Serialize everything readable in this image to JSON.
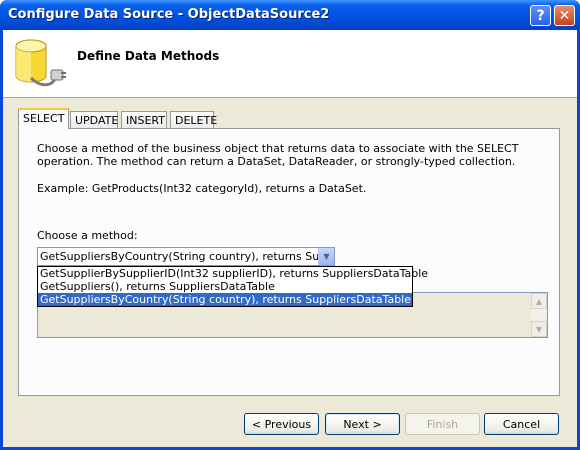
{
  "window": {
    "title": "Configure Data Source - ObjectDataSource2",
    "help_label": "?",
    "close_label": "✕"
  },
  "header": {
    "title": "Define Data Methods",
    "icon": "database-plug-icon"
  },
  "tabs": [
    {
      "label": "SELECT",
      "active": true
    },
    {
      "label": "UPDATE",
      "active": false
    },
    {
      "label": "INSERT",
      "active": false
    },
    {
      "label": "DELETE",
      "active": false
    }
  ],
  "select_tab": {
    "description": "Choose a method of the business object that returns data to associate with the SELECT operation. The method can return a DataSet, DataReader, or strongly-typed collection.",
    "example": "Example: GetProducts(Int32 categoryId), returns a DataSet.",
    "choose_label": "Choose a method:",
    "combo_value": "GetSuppliersByCountry(String country), returns SuppliersDataTable",
    "options": [
      "GetSupplierBySupplierID(Int32 supplierID), returns SuppliersDataTable",
      "GetSuppliers(), returns SuppliersDataTable",
      "GetSuppliersByCountry(String country), returns SuppliersDataTable"
    ],
    "selected_index": 2
  },
  "buttons": {
    "previous": "< Previous",
    "next": "Next >",
    "finish": "Finish",
    "cancel": "Cancel"
  },
  "colors": {
    "titlebar": "#0054e3",
    "selection": "#316ac5",
    "tab_accent": "#ffc83c"
  }
}
